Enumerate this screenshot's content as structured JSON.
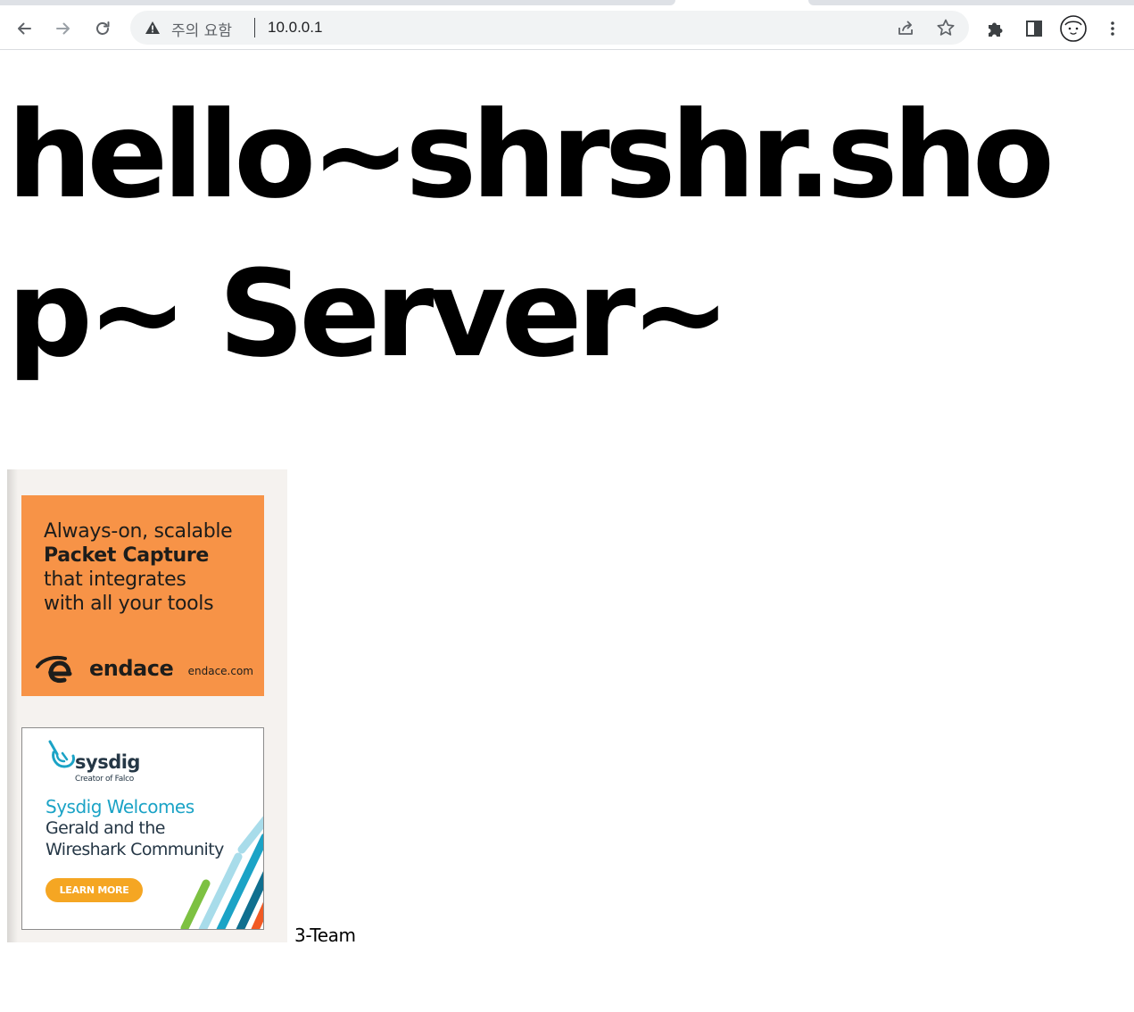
{
  "browser": {
    "address_warning": "주의 요함",
    "url": "10.0.0.1",
    "buttons": {
      "back": "arrow-left-icon",
      "forward": "arrow-right-icon",
      "reload": "reload-icon",
      "share": "share-icon",
      "bookmark": "star-icon",
      "extensions": "puzzle-icon",
      "side_panel": "side-panel-icon",
      "profile": "profile-avatar-icon",
      "menu": "kebab-menu-icon"
    }
  },
  "page": {
    "heading": "hello~shrshr.shop~ Server~",
    "footer_text": "3-Team"
  },
  "ads": {
    "endace": {
      "line1": "Always-on, scalable",
      "line2": "Packet Capture",
      "line3": "that integrates",
      "line4": "with all your tools",
      "brand": "endace",
      "domain": "endace.com",
      "background": "#f79347"
    },
    "sysdig": {
      "brand": "sysdig",
      "tagline": "Creator of Falco",
      "headline": "Sysdig Welcomes",
      "line2": "Gerald and the",
      "line3": "Wireshark Community",
      "cta": "LEARN MORE",
      "accent": "#1ba3c6",
      "cta_color": "#f5a623"
    }
  }
}
